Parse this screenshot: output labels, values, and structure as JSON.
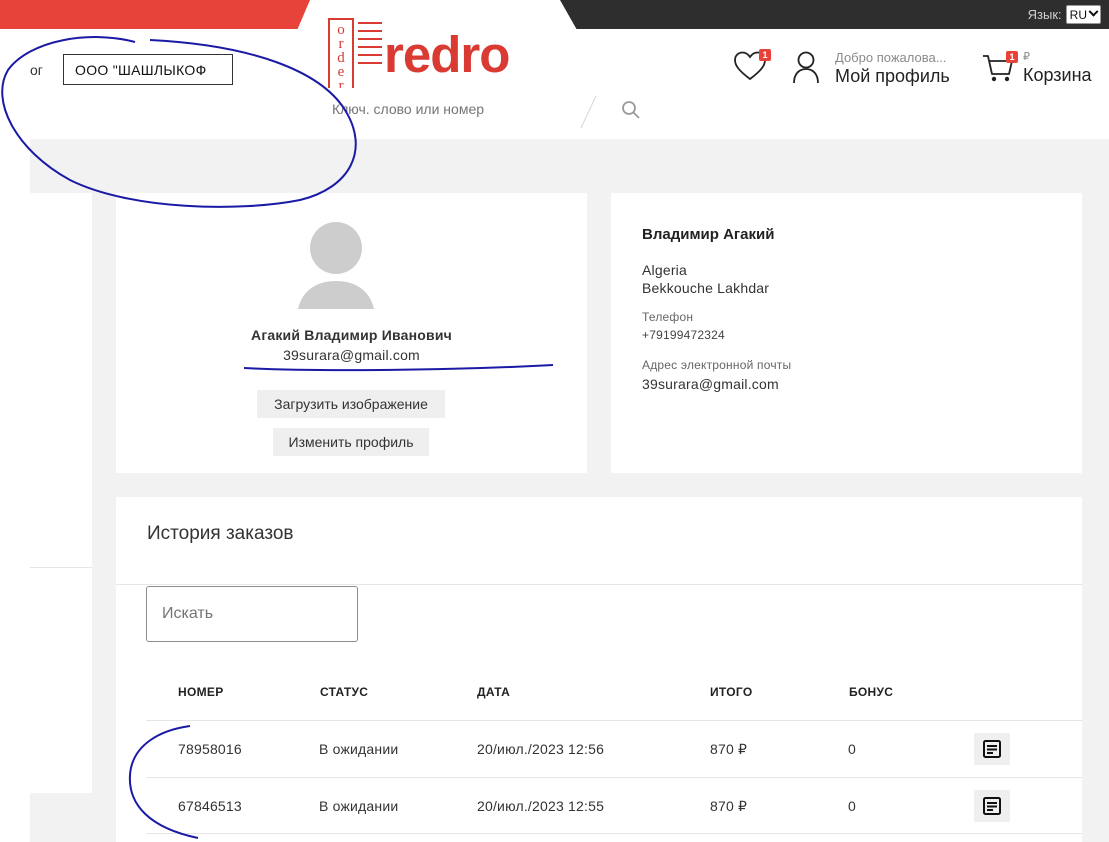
{
  "topbar": {
    "lang_label": "Язык:",
    "lang_value": "RU"
  },
  "header": {
    "catalog_tail": "ог",
    "company": "ООО \"ШАШЛЫКОФ",
    "logo_vertical": "o r d e r",
    "logo_word": "redro",
    "search_placeholder": "Ключ. слово или номер",
    "wishlist_badge": "1",
    "profile_welcome": "Добро пожалова...",
    "profile_name": "Мой профиль",
    "cart_badge": "1",
    "cart_currency": "₽",
    "cart_label": "Корзина"
  },
  "profile_card": {
    "full_name": "Агакий Владимир Иванович",
    "email": "39surara@gmail.com",
    "upload_button": "Загрузить изображение",
    "edit_button": "Изменить профиль"
  },
  "info_card": {
    "name": "Владимир Агакий",
    "country": "Algeria",
    "address": "Bekkouche Lakhdar",
    "phone_label": "Телефон",
    "phone": "+79199472324",
    "email_label": "Адрес электронной почты",
    "email": "39surara@gmail.com"
  },
  "orders": {
    "title": "История заказов",
    "search_placeholder": "Искать",
    "columns": [
      "НОМЕР",
      "СТАТУС",
      "ДАТА",
      "ИТОГО",
      "БОНУС"
    ],
    "rows": [
      {
        "number": "78958016",
        "status": "В ожидании",
        "date": "20/июл./2023 12:56",
        "total": "870 ₽",
        "bonus": "0"
      },
      {
        "number": "67846513",
        "status": "В ожидании",
        "date": "20/июл./2023 12:55",
        "total": "870 ₽",
        "bonus": "0"
      }
    ]
  },
  "colors": {
    "brand_red": "#e8433a",
    "dark_bar": "#2e2e2e",
    "annotation_blue": "#1a1aa6"
  },
  "icons": [
    "heart-icon",
    "user-icon",
    "cart-icon",
    "search-icon",
    "document-icon",
    "avatar-placeholder",
    "chevron-down-icon"
  ]
}
